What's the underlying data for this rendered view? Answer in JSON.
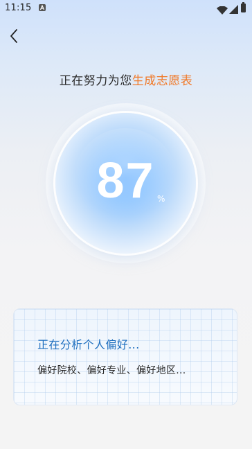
{
  "status_bar": {
    "time": "11:15",
    "notification_icon": "a-notification-icon",
    "wifi_icon": "wifi-icon",
    "signal_icon": "cell-signal-icon",
    "battery_icon": "battery-icon"
  },
  "nav": {
    "back_icon": "chevron-left-icon"
  },
  "heading": {
    "prefix": "正在努力为您",
    "highlight": "生成志愿表",
    "highlight_color": "#f07a2a"
  },
  "progress": {
    "value": "87",
    "unit": "%",
    "orb_color": "#8cc4ff"
  },
  "card": {
    "title": "正在分析个人偏好...",
    "subtitle": "偏好院校、偏好专业、偏好地区...",
    "title_color": "#1f6fbf"
  }
}
